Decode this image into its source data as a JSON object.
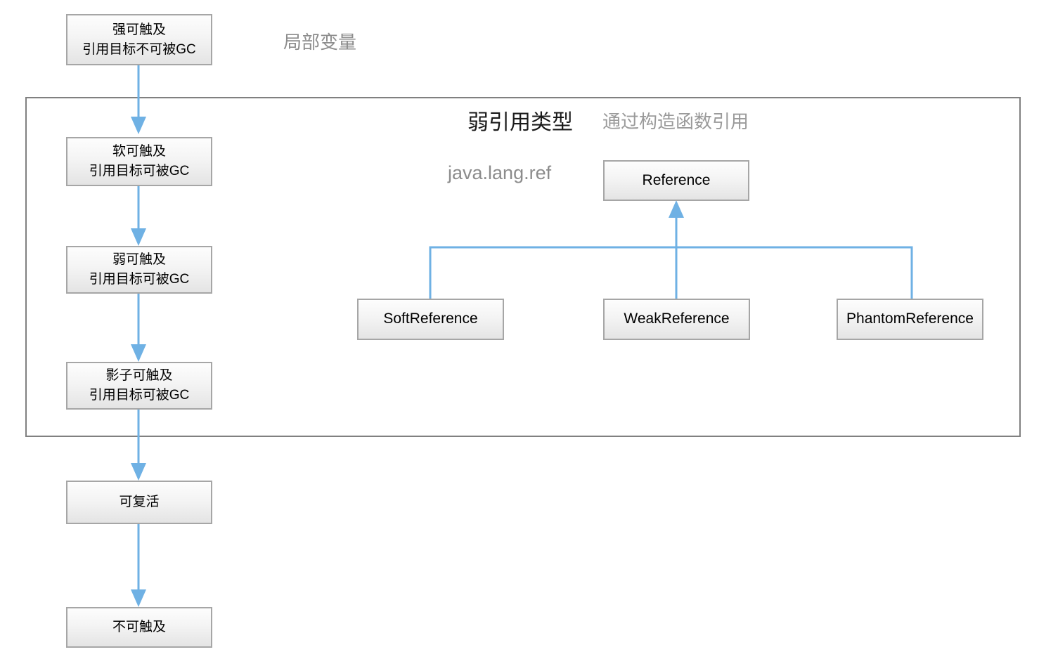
{
  "diagram": {
    "title_main": "弱引用类型",
    "title_note": "通过构造函数引用",
    "package_label": "java.lang.ref",
    "local_var_label": "局部变量",
    "accent_color": "#6fb1e4",
    "box_border_color": "#a6a6a6",
    "panel_border_color": "#808080",
    "label_gray": "#8c8c8c"
  },
  "reachability_chain": {
    "nodes": [
      {
        "id": "strong",
        "line1": "强可触及",
        "line2": "引用目标不可被GC"
      },
      {
        "id": "soft",
        "line1": "软可触及",
        "line2": "引用目标可被GC"
      },
      {
        "id": "weak",
        "line1": "弱可触及",
        "line2": "引用目标可被GC"
      },
      {
        "id": "phantom",
        "line1": "影子可触及",
        "line2": "引用目标可被GC"
      },
      {
        "id": "resurrectable",
        "line1": "可复活",
        "line2": ""
      },
      {
        "id": "unreachable",
        "line1": "不可触及",
        "line2": ""
      }
    ]
  },
  "class_hierarchy": {
    "parent": {
      "id": "reference",
      "label": "Reference"
    },
    "children": [
      {
        "id": "soft-reference",
        "label": "SoftReference"
      },
      {
        "id": "weak-reference",
        "label": "WeakReference"
      },
      {
        "id": "phantom-reference",
        "label": "PhantomReference"
      }
    ]
  }
}
